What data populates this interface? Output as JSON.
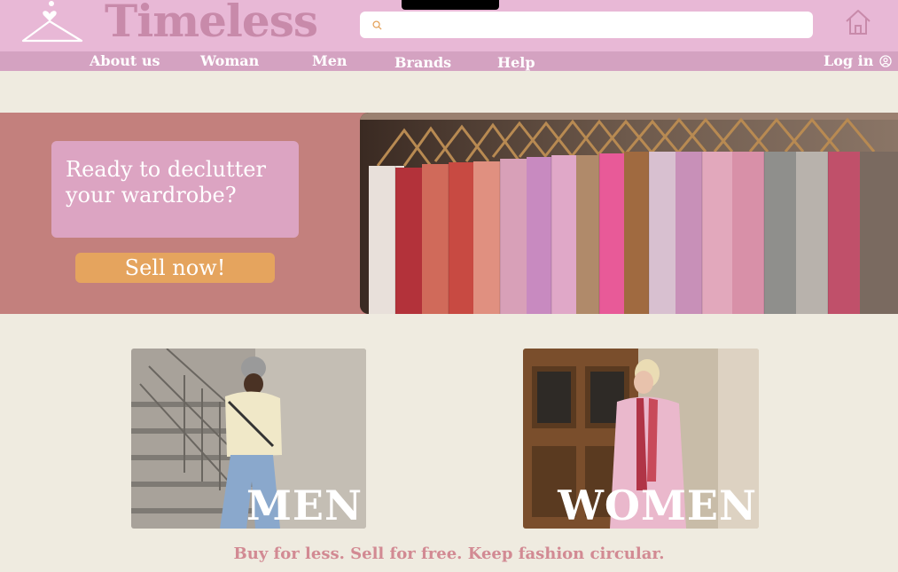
{
  "header": {
    "logo_text": "Timeless",
    "search_placeholder": "",
    "icons": [
      "hanger-heart-icon",
      "search-icon",
      "home-icon",
      "user-icon"
    ]
  },
  "nav": {
    "items": [
      "About us",
      "Woman",
      "Men",
      "Brands",
      "Help"
    ],
    "login_label": "Log in"
  },
  "hero": {
    "heading": "Ready to declutter your wardrobe?",
    "cta_label": "Sell now!"
  },
  "categories": [
    {
      "label": "MEN"
    },
    {
      "label": "WOMEN"
    }
  ],
  "tagline": "Buy for less. Sell for free. Keep fashion circular.",
  "colors": {
    "header_bg": "#e8b8d6",
    "nav_bg": "#d4a2c1",
    "page_bg": "#efebe0",
    "hero_bg": "#c3807d",
    "hero_box": "#dca4c2",
    "cta": "#e5a45e",
    "logo": "#c88aaa",
    "tagline": "#d28a93"
  }
}
